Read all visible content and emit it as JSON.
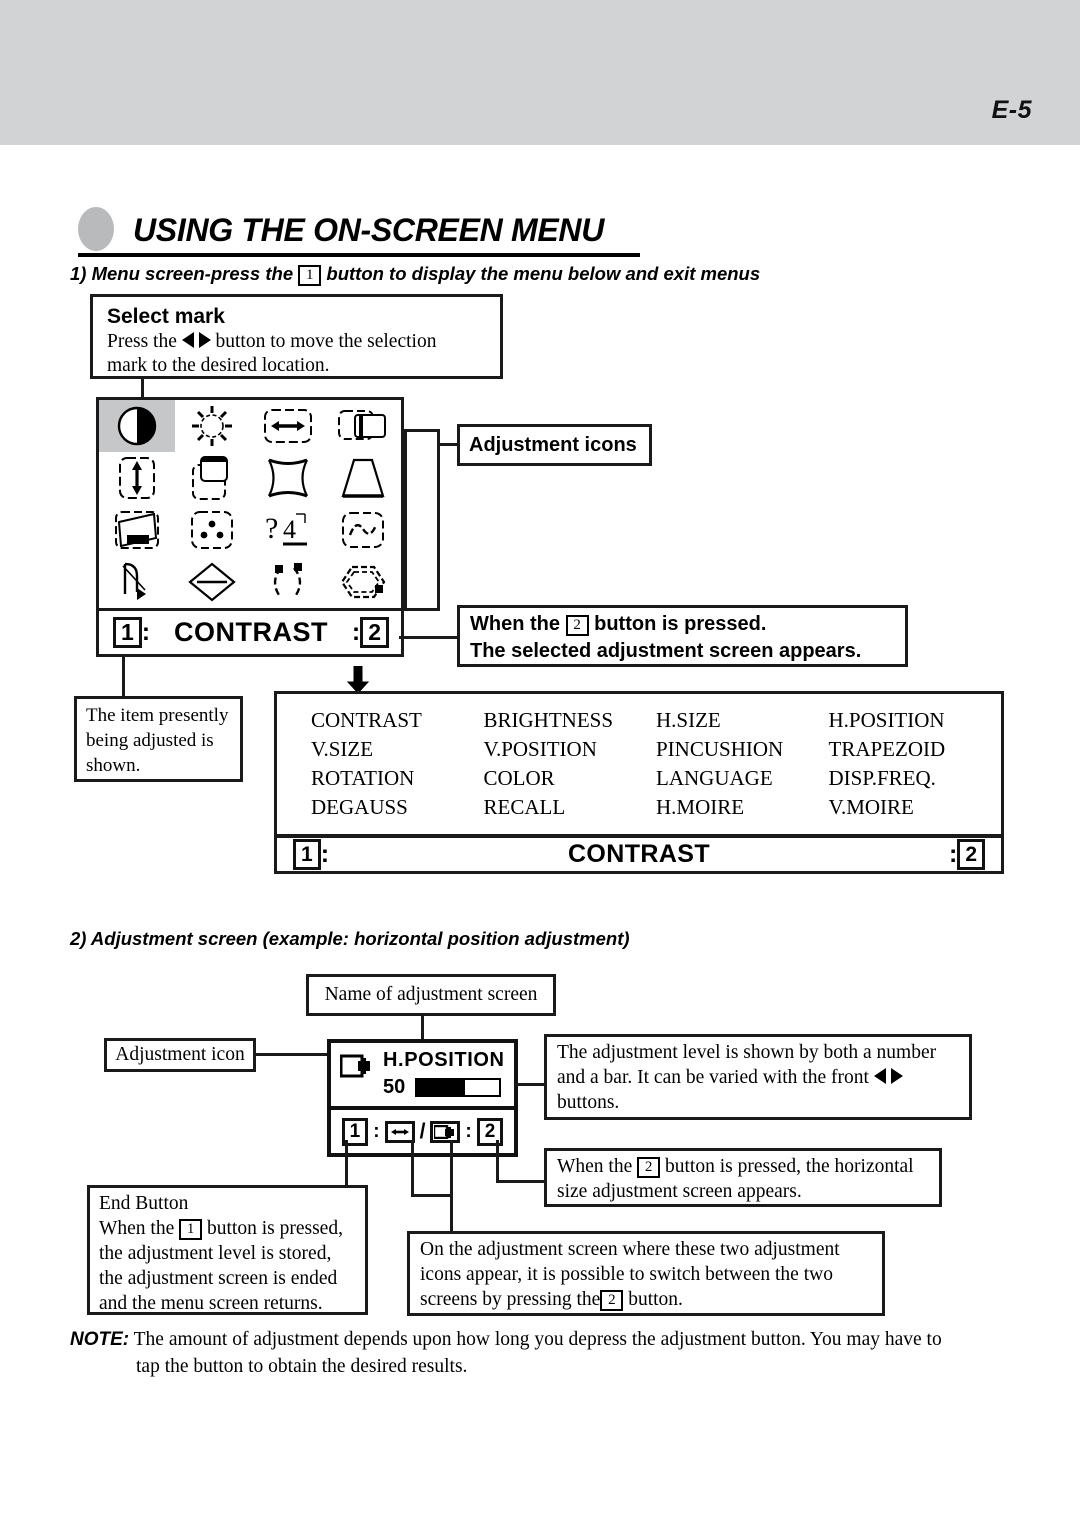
{
  "header": {
    "page_number": "E-5"
  },
  "title": {
    "text": "USING THE ON-SCREEN MENU"
  },
  "step1": {
    "prefix": "1) Menu screen-press the",
    "key": "1",
    "suffix": "button to display the menu below and exit menus"
  },
  "select_mark": {
    "title": "Select mark",
    "line1_a": "Press the",
    "line1_b": "button to move the selection",
    "line2": "mark to the desired location."
  },
  "osd_menu": {
    "icons": [
      {
        "name": "contrast-icon",
        "label": "CONTRAST",
        "selected": true
      },
      {
        "name": "brightness-icon",
        "label": "BRIGHTNESS",
        "selected": false
      },
      {
        "name": "h-size-icon",
        "label": "H.SIZE",
        "selected": false
      },
      {
        "name": "h-position-icon",
        "label": "H.POSITION",
        "selected": false
      },
      {
        "name": "v-size-icon",
        "label": "V.SIZE",
        "selected": false
      },
      {
        "name": "v-position-icon",
        "label": "V.POSITION",
        "selected": false
      },
      {
        "name": "pincushion-icon",
        "label": "PINCUSHION",
        "selected": false
      },
      {
        "name": "trapezoid-icon",
        "label": "TRAPEZOID",
        "selected": false
      },
      {
        "name": "rotation-icon",
        "label": "ROTATION",
        "selected": false
      },
      {
        "name": "color-icon",
        "label": "COLOR",
        "selected": false
      },
      {
        "name": "language-icon",
        "label": "LANGUAGE",
        "selected": false
      },
      {
        "name": "disp-freq-icon",
        "label": "DISP.FREQ.",
        "selected": false
      },
      {
        "name": "degauss-icon",
        "label": "DEGAUSS",
        "selected": false
      },
      {
        "name": "recall-icon",
        "label": "RECALL",
        "selected": false
      },
      {
        "name": "h-moire-icon",
        "label": "H.MOIRE",
        "selected": false
      },
      {
        "name": "v-moire-icon",
        "label": "V.MOIRE",
        "selected": false
      }
    ],
    "footer": {
      "left_key": "1",
      "label": "CONTRAST",
      "right_key": "2"
    }
  },
  "callouts": {
    "adjustment_icons": "Adjustment icons",
    "when_button2": {
      "line1_a": "When the",
      "key": "2",
      "line1_b": "button is pressed.",
      "line2": "The selected adjustment screen appears."
    },
    "item_shown": "The item presently being adjusted is shown."
  },
  "menu_panel": {
    "items": [
      "CONTRAST",
      "BRIGHTNESS",
      "H.SIZE",
      "H.POSITION",
      "V.SIZE",
      "V.POSITION",
      "PINCUSHION",
      "TRAPEZOID",
      "ROTATION",
      "COLOR",
      "LANGUAGE",
      "DISP.FREQ.",
      "DEGAUSS",
      "RECALL",
      "H.MOIRE",
      "V.MOIRE"
    ],
    "footer": {
      "left_key": "1",
      "label": "CONTRAST",
      "right_key": "2"
    }
  },
  "step2": {
    "text": "2) Adjustment screen (example: horizontal position adjustment)"
  },
  "adjustment_screen": {
    "name_label": "Name of adjustment screen",
    "icon_label": "Adjustment icon",
    "title": "H.POSITION",
    "value": "50",
    "bar_percent": 58,
    "footer": {
      "left_key": "1",
      "slash": "/",
      "right_key": "2",
      "left_icon": "h-position-arrows-icon",
      "right_icon": "h-size-icon"
    }
  },
  "notes": {
    "level": {
      "a": "The adjustment level is shown by both a number",
      "b": "and a bar. It can be varied with the front",
      "c": "buttons."
    },
    "when_button2b": {
      "a": "When the",
      "key": "2",
      "b": "button is pressed, the horizontal",
      "c": "size adjustment screen appears."
    },
    "end_button": {
      "title": "End Button",
      "a": "When the",
      "key": "1",
      "b": "button is pressed,",
      "c": "the adjustment level is stored,",
      "d": "the adjustment screen is ended",
      "e": "and the menu screen returns."
    },
    "two_icons": {
      "a": "On the adjustment screen where these two adjustment",
      "b": "icons appear, it is possible to switch between the two",
      "c": "screens by pressing the",
      "key": "2",
      "d": "button."
    },
    "note": {
      "label": "NOTE:",
      "line1": "The amount of adjustment depends upon how long you depress the adjustment button. You may have to",
      "line2": "tap the button to obtain the desired results."
    }
  }
}
